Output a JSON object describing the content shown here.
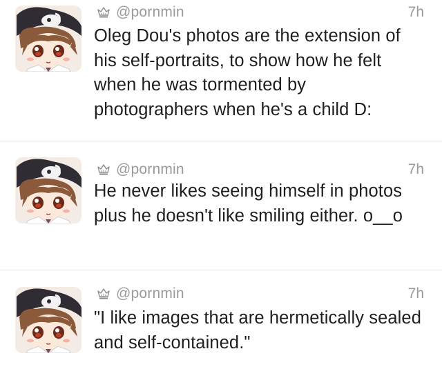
{
  "tweets": [
    {
      "handle": "@pornmin",
      "time": "7h",
      "text": "Oleg Dou's photos are the extension of his self-portraits, to show how he felt when he was tormented by photographers when he's a child D:"
    },
    {
      "handle": "@pornmin",
      "time": "7h",
      "text": "He never likes seeing himself in photos plus he doesn't like smiling either. o__o"
    },
    {
      "handle": "@pornmin",
      "time": "7h",
      "text": "\"I like images that are hermetically sealed and self-contained.\""
    }
  ],
  "icons": {
    "badge": "crown-icon",
    "avatar": "cartoon-avatar"
  },
  "colors": {
    "meta_text": "#9a9a9a",
    "body_text": "#1e1e1e",
    "divider": "#e1e1e1"
  }
}
